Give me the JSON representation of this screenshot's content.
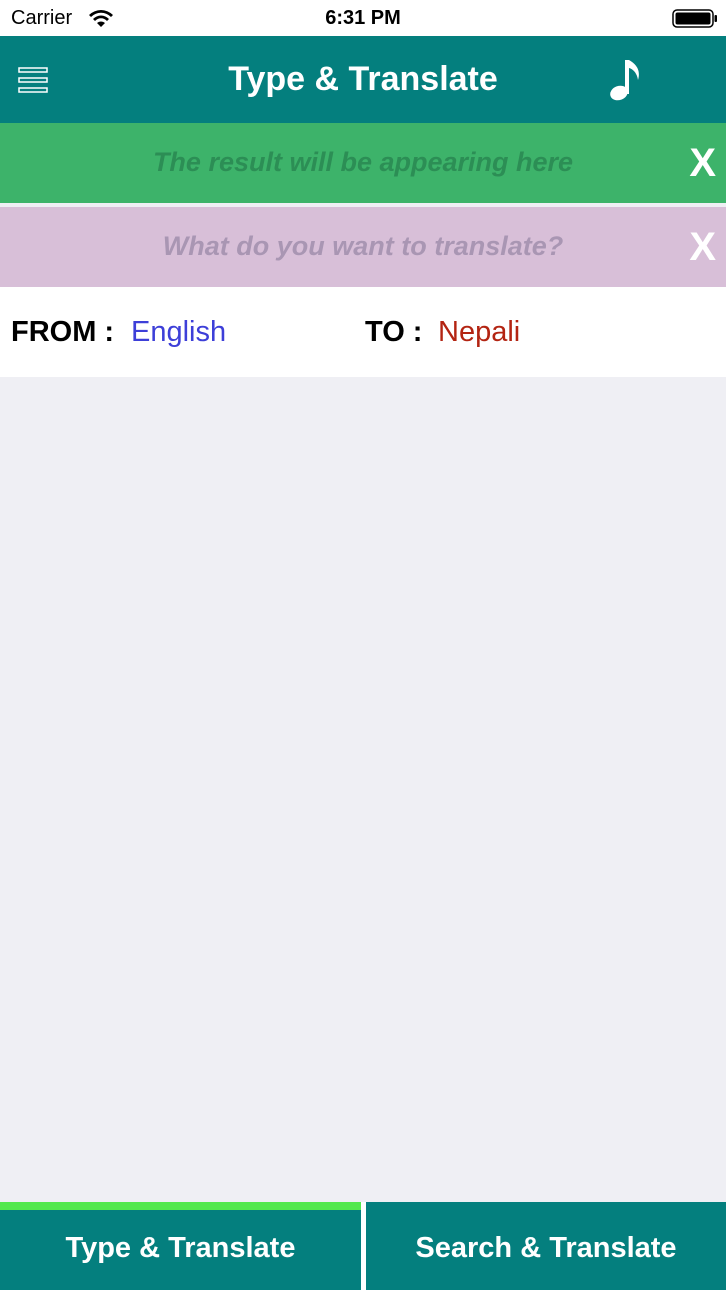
{
  "status_bar": {
    "carrier": "Carrier",
    "time": "6:31 PM",
    "wifi_icon": "wifi-icon",
    "battery_icon": "battery-icon"
  },
  "header": {
    "title": "Type & Translate",
    "menu_icon": "hamburger-menu-icon",
    "music_icon": "music-note-icon",
    "color": "#047f7e"
  },
  "result": {
    "placeholder": "The result will be appearing here",
    "clear_label": "X",
    "color": "#3db36a"
  },
  "input": {
    "placeholder": "What do you want to translate?",
    "clear_label": "X",
    "color": "#d8bfd8"
  },
  "languages": {
    "from_label": "FROM :",
    "from_value": "English",
    "to_label": "TO :",
    "to_value": "Nepali"
  },
  "tabs": [
    {
      "label": "Type & Translate",
      "active": true
    },
    {
      "label": "Search & Translate",
      "active": false
    }
  ],
  "colors": {
    "active_tab_indicator": "#52e84d",
    "background": "#efeff4"
  }
}
